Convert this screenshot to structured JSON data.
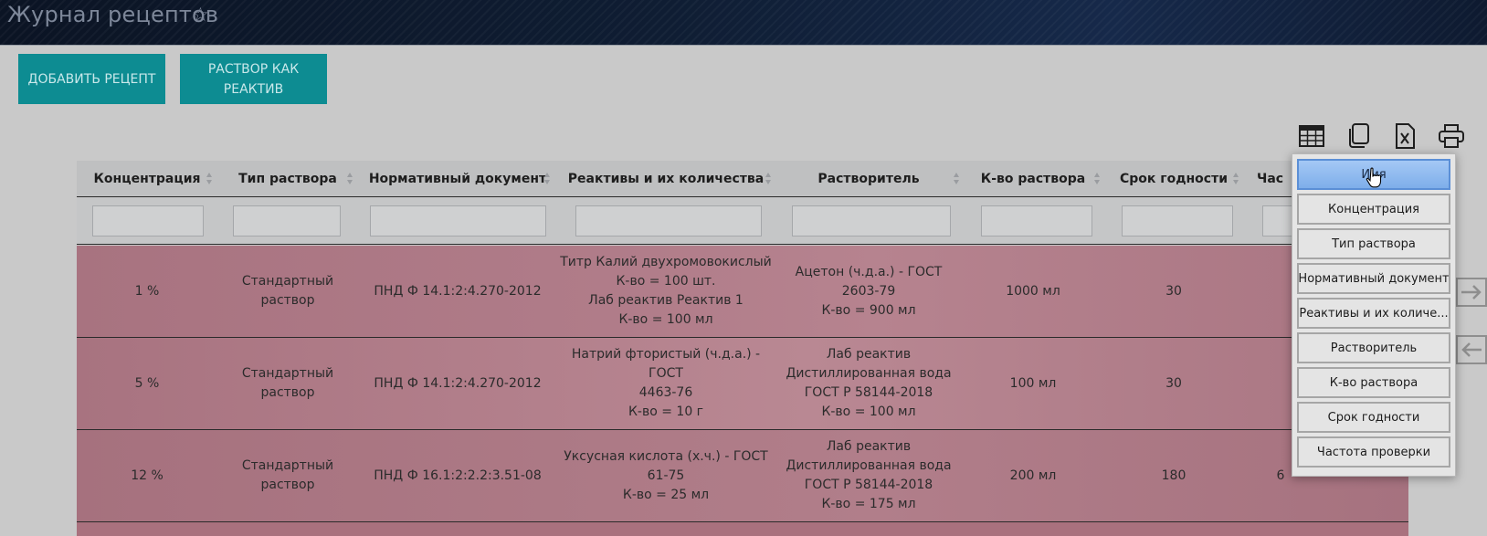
{
  "header": {
    "title": "Журнал рецептов",
    "star_icon": "star-outline-icon"
  },
  "actions": {
    "add_recipe": "ДОБАВИТЬ РЕЦЕПТ",
    "solution_as_reagent": "РАСТВОР КАК РЕАКТИВ"
  },
  "toolbar": {
    "icons": [
      "table-columns-icon",
      "copy-icon",
      "excel-export-icon",
      "print-icon"
    ]
  },
  "table": {
    "columns": [
      "Концентрация",
      "Тип раствора",
      "Нормативный документ",
      "Реактивы и их количества",
      "Растворитель",
      "К-во раствора",
      "Срок годности",
      "Час"
    ],
    "rows": [
      {
        "concentration": "1 %",
        "type": [
          "Стандартный",
          "раствор"
        ],
        "doc": "ПНД Ф 14.1:2:4.270-2012",
        "reagents": [
          "Титр Калий двухромовокислый",
          "К-во = 100 шт.",
          "Лаб реактив Реактив 1",
          "К-во = 100 мл"
        ],
        "solvent": [
          "Ацетон (ч.д.а.) - ГОСТ",
          "2603-79",
          "К-во = 900 мл"
        ],
        "amount": "1000 мл",
        "shelf": "30",
        "freq": ""
      },
      {
        "concentration": "5 %",
        "type": [
          "Стандартный",
          "раствор"
        ],
        "doc": "ПНД Ф 14.1:2:4.270-2012",
        "reagents": [
          "Натрий фтористый (ч.д.а.) - ГОСТ",
          "4463-76",
          "К-во = 10 г"
        ],
        "solvent": [
          "Лаб реактив",
          "Дистиллированная вода",
          "ГОСТ Р 58144-2018",
          "К-во = 100 мл"
        ],
        "amount": "100 мл",
        "shelf": "30",
        "freq": ""
      },
      {
        "concentration": "12 %",
        "type": [
          "Стандартный",
          "раствор"
        ],
        "doc": "ПНД Ф 16.1:2:2.2:3.51-08",
        "reagents": [
          "Уксусная кислота (х.ч.) - ГОСТ",
          "61-75",
          "К-во = 25 мл"
        ],
        "solvent": [
          "Лаб реактив",
          "Дистиллированная вода",
          "ГОСТ Р 58144-2018",
          "К-во = 175 мл"
        ],
        "amount": "200 мл",
        "shelf": "180",
        "freq": "6"
      }
    ]
  },
  "column_menu": {
    "items": [
      "Имя",
      "Концентрация",
      "Тип раствора",
      "Нормативный документ",
      "Реактивы и их количе...",
      "Растворитель",
      "К-во раствора",
      "Срок годности",
      "Частота проверки"
    ],
    "active_index": 0
  },
  "colors": {
    "row_highlight": "#b37d8a",
    "teal": "#0d8c92",
    "header_bg": "#0f1d33",
    "menu_active": "#8db8ef"
  }
}
